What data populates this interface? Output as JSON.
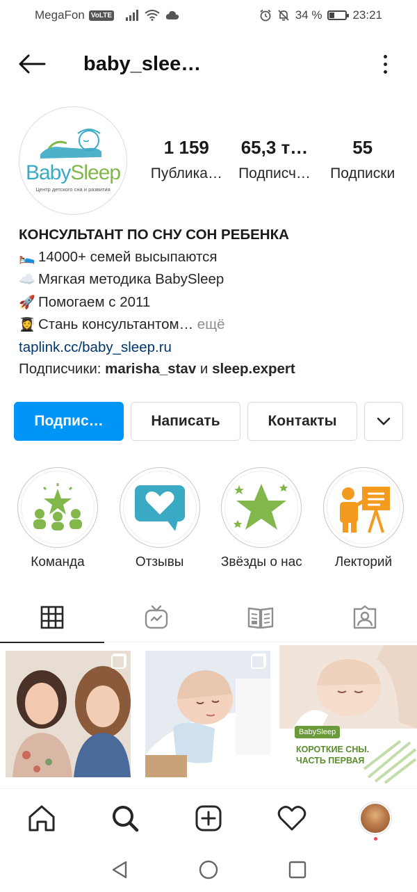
{
  "status_bar": {
    "carrier": "MegaFon",
    "volte": "VoLTE",
    "battery": "34 %",
    "battery_level": 0.34,
    "time": "23:21"
  },
  "header": {
    "username": "baby_slee…",
    "back_icon": "arrow-left-icon",
    "more_icon": "more-vertical-icon"
  },
  "profile": {
    "avatar_logo_text_a": "Baby",
    "avatar_logo_text_b": "Sleep",
    "avatar_logo_sub": "Центр детского сна и развития",
    "stats": [
      {
        "value": "1 159",
        "label": "Публика…"
      },
      {
        "value": "65,3 т…",
        "label": "Подписч…"
      },
      {
        "value": "55",
        "label": "Подписки"
      }
    ]
  },
  "bio": {
    "title": "КОНСУЛЬТАНТ ПО СНУ СОН РЕБЕНКА",
    "lines": [
      {
        "emoji": "🛌",
        "text": "14000+ семей высыпаются"
      },
      {
        "emoji": "☁️",
        "text": "Мягкая методика BabySleep"
      },
      {
        "emoji": "🚀",
        "text": "Помогаем с 2011"
      },
      {
        "emoji": "👩‍🎓",
        "text": "Стань консультантом…"
      }
    ],
    "more": " ещё",
    "link": "taplink.cc/baby_sleep.ru",
    "followers_prefix": "Подписчики: ",
    "follower_1": "marisha_stav",
    "followers_and": " и ",
    "follower_2": "sleep.expert"
  },
  "buttons": {
    "follow": "Подпис…",
    "message": "Написать",
    "contacts": "Контакты",
    "dropdown_icon": "chevron-down-icon"
  },
  "highlights": [
    {
      "label": "Команда",
      "icon": "team-star-icon"
    },
    {
      "label": "Отзывы",
      "icon": "heart-bubble-icon"
    },
    {
      "label": "Звёзды о нас",
      "icon": "star-icon"
    },
    {
      "label": "Лекторий",
      "icon": "lecturer-icon"
    }
  ],
  "tabs": [
    "grid-icon",
    "igtv-icon",
    "guides-icon",
    "tagged-icon"
  ],
  "posts": {
    "post3_badge": "BabySleep",
    "post3_title": "КОРОТКИЕ СНЫ. ЧАСТЬ ПЕРВАЯ"
  },
  "bottom_nav": [
    "home-icon",
    "search-icon",
    "add-post-icon",
    "heart-icon",
    "profile-avatar"
  ],
  "colors": {
    "accent": "#0095f6",
    "link": "#00376b",
    "brand_green": "#82b74b",
    "brand_blue": "#3aa9c4",
    "highlight_orange": "#f39a1f"
  }
}
